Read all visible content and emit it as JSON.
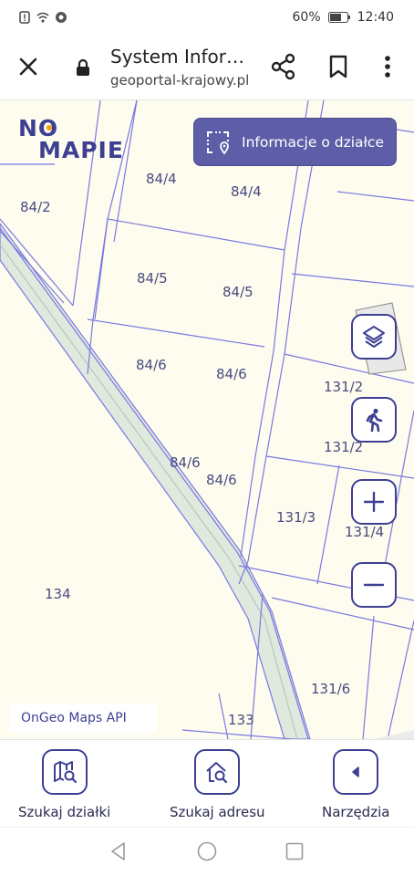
{
  "status_bar": {
    "battery": "60%",
    "time": "12:40"
  },
  "browser": {
    "title": "System Infor…",
    "url": "geoportal-krajowy.pl"
  },
  "map": {
    "logo_top": "NO",
    "logo_bottom": "MAPIE",
    "info_button": "Informacje o działce",
    "attribution": "OnGeo Maps API",
    "parcel_labels": [
      "84/2",
      "84/4",
      "84/4",
      "84/5",
      "84/5",
      "84/6",
      "84/6",
      "84/6",
      "84/6",
      "131/2",
      "131/2",
      "131/3",
      "131/4",
      "134",
      "131/6",
      "133"
    ],
    "controls": [
      "layers-icon",
      "pedestrian-icon",
      "zoom-in-icon",
      "zoom-out-icon"
    ]
  },
  "toolbar": {
    "items": [
      {
        "label": "Szukaj działki",
        "icon": "map-search-icon"
      },
      {
        "label": "Szukaj adresu",
        "icon": "home-search-icon"
      },
      {
        "label": "Narzędzia",
        "icon": "chevron-left-icon"
      }
    ]
  },
  "colors": {
    "brand": "#3d3f93",
    "info_button_bg": "#5e5ea8",
    "map_bg": "#fdfcee",
    "parcel_line": "#7b78e0",
    "road_fill": "#dfe9de"
  }
}
